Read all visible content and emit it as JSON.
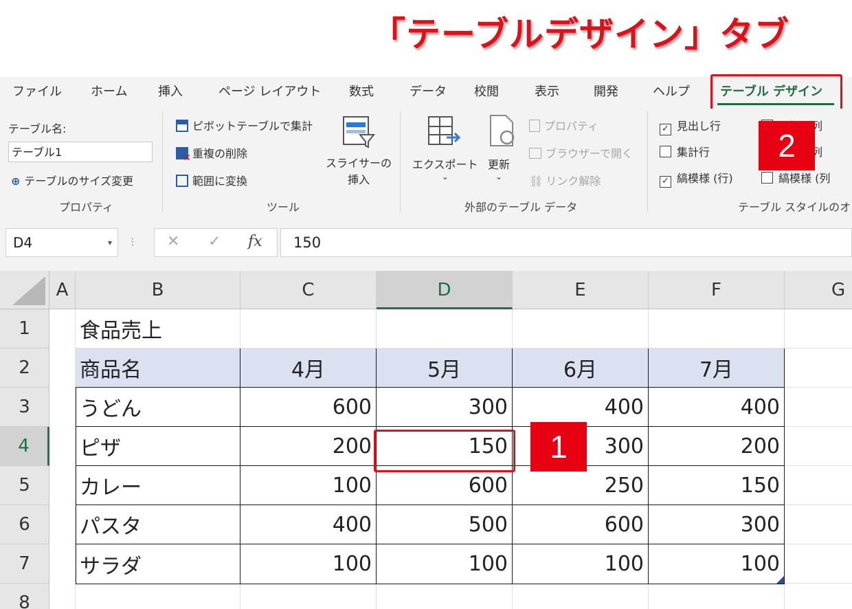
{
  "headline": "「テーブルデザイン」タブ",
  "menu_tabs": [
    "ファイル",
    "ホーム",
    "挿入",
    "ページ レイアウト",
    "数式",
    "データ",
    "校閲",
    "表示",
    "開発",
    "ヘルプ",
    "テーブル デザイン"
  ],
  "active_tab": "テーブル デザイン",
  "ribbon": {
    "properties": {
      "table_name_label": "テーブル名:",
      "table_name_value": "テーブル1",
      "resize": "テーブルのサイズ変更",
      "group": "プロパティ"
    },
    "tools": {
      "pivot": "ピボットテーブルで集計",
      "remove_dup": "重複の削除",
      "convert": "範囲に変換",
      "slicer_1": "スライサーの",
      "slicer_2": "挿入",
      "group": "ツール"
    },
    "external": {
      "export": "エクスポート",
      "refresh": "更新",
      "properties": "プロパティ",
      "open_browser": "ブラウザーで開く",
      "unlink": "リンク解除",
      "group": "外部のテーブル データ"
    },
    "style_options": {
      "header_row": "見出し行",
      "header_row_checked": true,
      "total_row": "集計行",
      "total_row_checked": false,
      "banded_rows": "縞模様 (行)",
      "banded_rows_checked": true,
      "first_col": "最初の列",
      "last_col": "最後の列",
      "banded_cols": "縞模様 (列",
      "group": "テーブル スタイルのオ"
    }
  },
  "formula_bar": {
    "name_box": "D4",
    "fx": "fx",
    "cancel": "✕",
    "enter": "✓",
    "formula": "150"
  },
  "grid": {
    "columns": [
      "A",
      "B",
      "C",
      "D",
      "E",
      "F",
      "G"
    ],
    "rows": [
      "1",
      "2",
      "3",
      "4",
      "5",
      "6",
      "7",
      "8"
    ],
    "selected_cell": "D4",
    "title": "食品売上",
    "headers": [
      "商品名",
      "4月",
      "5月",
      "6月",
      "7月"
    ],
    "data": [
      {
        "name": "うどん",
        "values": [
          "600",
          "300",
          "400",
          "400"
        ]
      },
      {
        "name": "ピザ",
        "values": [
          "200",
          "150",
          "300",
          "200"
        ]
      },
      {
        "name": "カレー",
        "values": [
          "100",
          "600",
          "250",
          "150"
        ]
      },
      {
        "name": "パスタ",
        "values": [
          "400",
          "500",
          "600",
          "300"
        ]
      },
      {
        "name": "サラダ",
        "values": [
          "100",
          "100",
          "100",
          "100"
        ]
      }
    ]
  },
  "callouts": [
    "1",
    "2"
  ],
  "colors": {
    "accent_red": "#e60012",
    "excel_green": "#217346",
    "table_header": "#dbe1f1"
  }
}
